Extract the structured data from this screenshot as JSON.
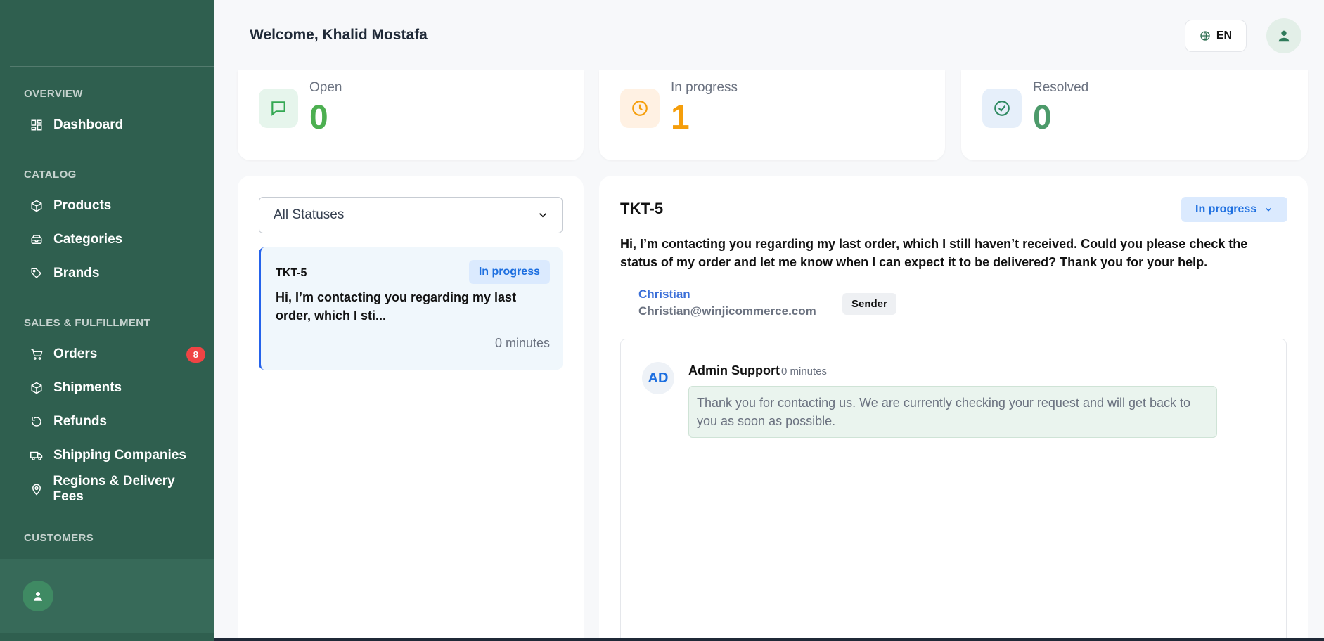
{
  "sidebar": {
    "sections": [
      {
        "title": "OVERVIEW"
      },
      {
        "title": "CATALOG"
      },
      {
        "title": "SALES & FULFILLMENT"
      },
      {
        "title": "CUSTOMERS"
      }
    ],
    "items": [
      {
        "label": "Dashboard",
        "icon": "dashboard-icon"
      },
      {
        "label": "Products",
        "icon": "box-icon"
      },
      {
        "label": "Categories",
        "icon": "tray-icon"
      },
      {
        "label": "Brands",
        "icon": "tag-icon"
      },
      {
        "label": "Orders",
        "icon": "cart-icon",
        "badge": "8"
      },
      {
        "label": "Shipments",
        "icon": "box-icon"
      },
      {
        "label": "Refunds",
        "icon": "refund-icon"
      },
      {
        "label": "Shipping Companies",
        "icon": "truck-icon"
      },
      {
        "label": "Regions & Delivery Fees",
        "icon": "map-pin-icon"
      }
    ]
  },
  "header": {
    "welcome": "Welcome, Khalid Mostafa",
    "language": "EN"
  },
  "stats": [
    {
      "label": "Open",
      "value": "0",
      "color": "#4caf50",
      "icon": "chat-icon"
    },
    {
      "label": "In progress",
      "value": "1",
      "color": "#f59e0b",
      "icon": "clock-icon"
    },
    {
      "label": "Resolved",
      "value": "0",
      "color": "#4c9a6a",
      "icon": "check-circle-icon"
    }
  ],
  "filter": {
    "selected": "All Statuses"
  },
  "tickets": [
    {
      "id": "TKT-5",
      "status": "In progress",
      "preview": "Hi, I’m contacting you regarding my last order, which I sti...",
      "time": "0 minutes"
    }
  ],
  "detail": {
    "id": "TKT-5",
    "status": "In progress",
    "message": "Hi, I’m contacting you regarding my last order, which I still haven’t received. Could you please check the status of my order and let me know when I can expect it to be delivered? Thank you for your help.",
    "sender": {
      "name": "Christian",
      "email": "Christian@winjicommerce.com",
      "tag": "Sender"
    },
    "reply": {
      "initials": "AD",
      "author": "Admin Support",
      "time": "0 minutes",
      "text": "Thank you for contacting us. We are currently checking your request and will get back to you as soon as possible."
    }
  },
  "colors": {
    "sidebar": "#2f5f4f",
    "accent_blue": "#1d6fe0",
    "badge_red": "#ef4444"
  }
}
